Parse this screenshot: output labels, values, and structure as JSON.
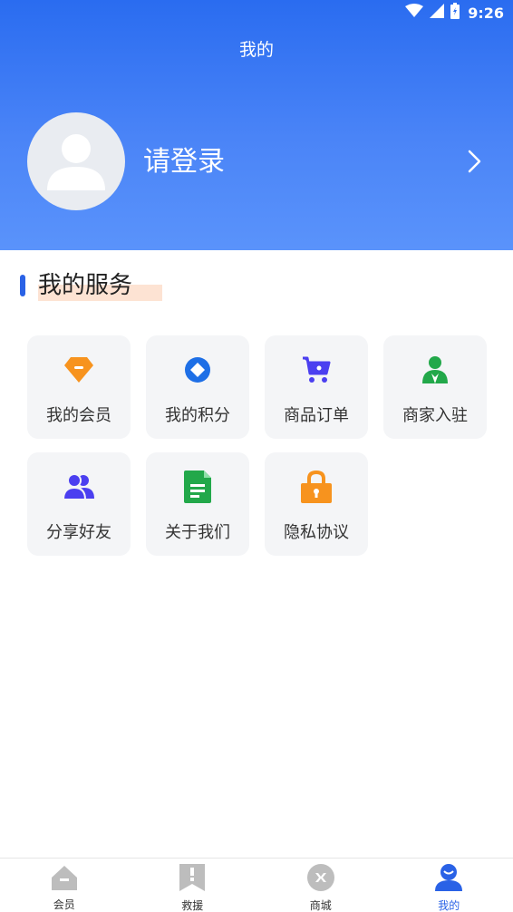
{
  "status_bar": {
    "time": "9:26"
  },
  "header": {
    "title": "我的"
  },
  "profile": {
    "login_label": "请登录"
  },
  "services": {
    "title": "我的服务",
    "items": [
      {
        "label": "我的会员",
        "icon": "diamond-icon",
        "color": "#f7931e"
      },
      {
        "label": "我的积分",
        "icon": "points-icon",
        "color": "#1e6fe6"
      },
      {
        "label": "商品订单",
        "icon": "cart-icon",
        "color": "#4b3ff0"
      },
      {
        "label": "商家入驻",
        "icon": "merchant-icon",
        "color": "#22a84a"
      },
      {
        "label": "分享好友",
        "icon": "users-icon",
        "color": "#4b3ff0"
      },
      {
        "label": "关于我们",
        "icon": "document-icon",
        "color": "#22a84a"
      },
      {
        "label": "隐私协议",
        "icon": "lock-icon",
        "color": "#f7931e"
      }
    ]
  },
  "tabbar": {
    "tabs": [
      {
        "label": "会员",
        "icon": "member-icon",
        "active": false
      },
      {
        "label": "救援",
        "icon": "rescue-icon",
        "active": false
      },
      {
        "label": "商城",
        "icon": "mall-icon",
        "active": false
      },
      {
        "label": "我的",
        "icon": "profile-icon",
        "active": true
      }
    ]
  },
  "colors": {
    "brand": "#2a62e6",
    "inactive_tab": "#bdbdbd",
    "card_bg": "#f4f5f7"
  }
}
